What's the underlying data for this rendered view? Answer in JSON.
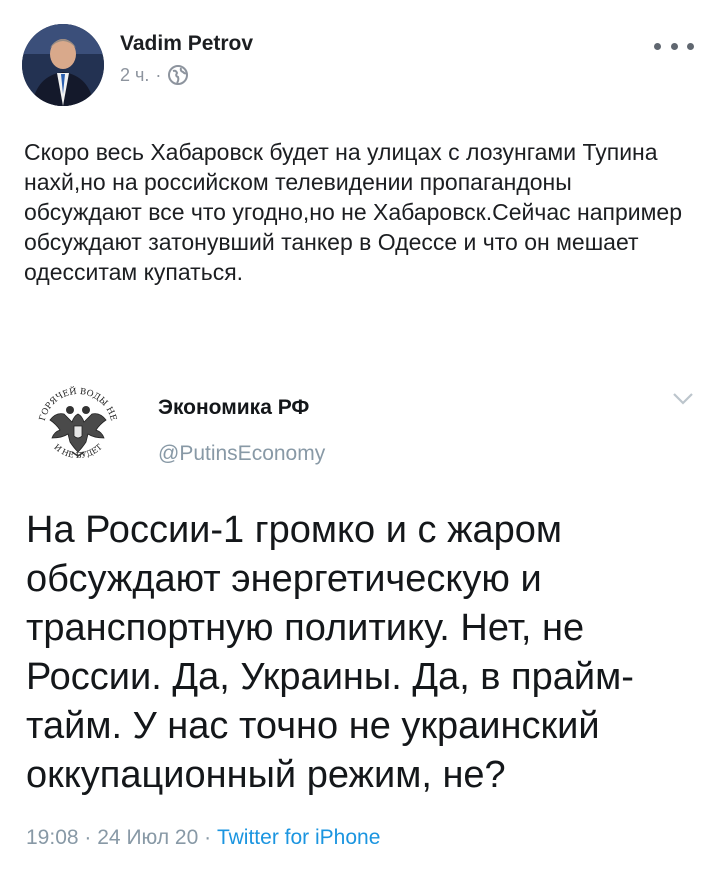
{
  "post": {
    "author": "Vadim Petrov",
    "time": "2 ч.",
    "separator": "·",
    "text": "Скоро весь Хабаровск будет на улицах с лозунгами Тупина нахй,но на российском телевидении пропагандоны обсуждают все что угодно,но не Хабаровск.Сейчас например обсуждают затонувший танкер в Одессе и что он мешает одесситам купаться."
  },
  "embedded_tweet": {
    "name": "Экономика РФ",
    "handle": "@PutinsEconomy",
    "avatar_text_top": "ГОРЯЧЕЙ ВОДЫ НЕ",
    "avatar_text_bottom": "И НЕ БУДЕТ",
    "text": "На России-1 громко и с жаром обсуждают энергетическую и транспортную политику. Нет, не России. Да, Украины. Да, в прайм-тайм. У нас точно не украинский оккупационный режим, не?",
    "time": "19:08",
    "date": "24 Июл 20",
    "dot": "·",
    "source": "Twitter for iPhone"
  },
  "colors": {
    "meta_gray": "#8d949e",
    "twitter_gray": "#8899a6",
    "twitter_blue": "#1b95e0"
  },
  "icons": {
    "avatar": "avatar-photo",
    "privacy": "globe-icon",
    "more": "more-options-icon",
    "tweet_menu": "chevron-down-icon"
  }
}
